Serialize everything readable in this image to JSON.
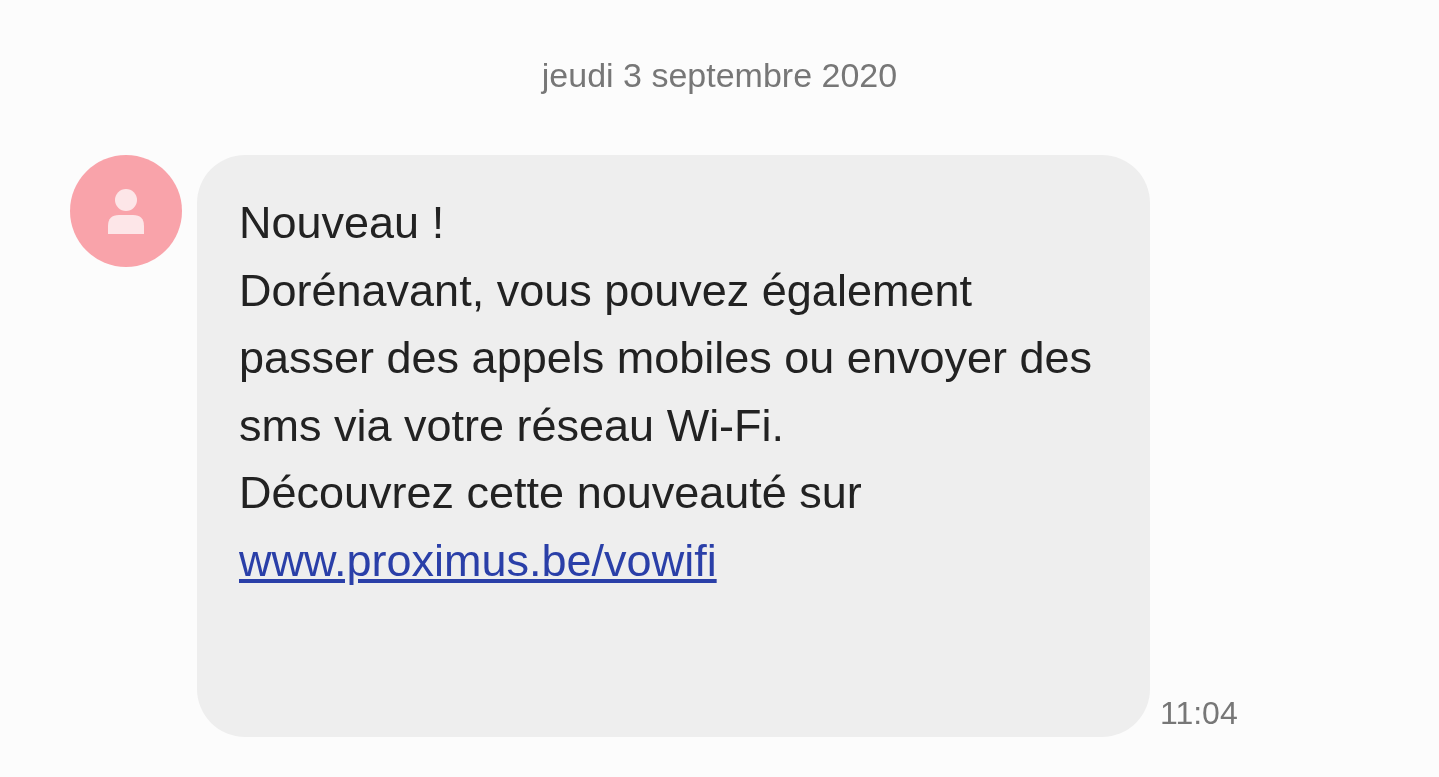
{
  "date_header": "jeudi 3 septembre 2020",
  "message": {
    "paragraphs": [
      "Nouveau !",
      "Dorénavant, vous pouvez également passer des appels mobiles ou envoyer des sms via votre réseau Wi-Fi.",
      "Découvrez cette nouveauté sur"
    ],
    "link": "www.proximus.be/vowifi",
    "time": "11:04"
  }
}
